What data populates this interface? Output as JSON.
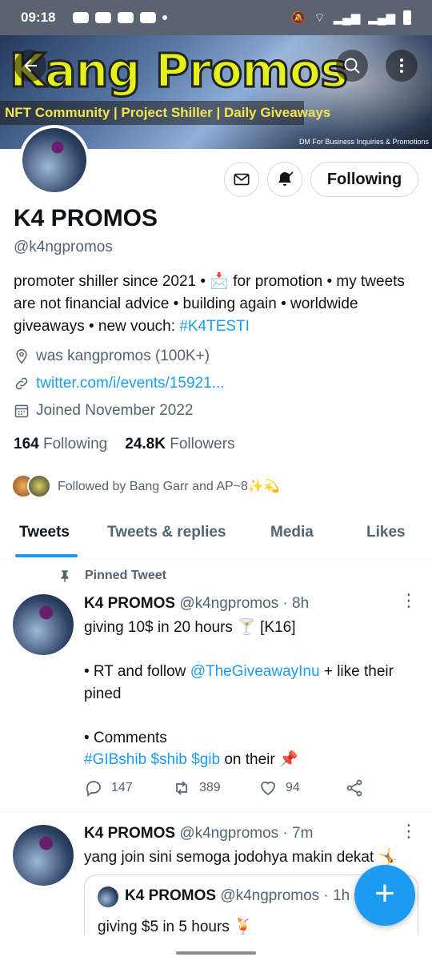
{
  "status_bar": {
    "time": "09:18"
  },
  "banner": {
    "brand": "Kang Promos",
    "tagline": "NFT Community | Project Shiller | Daily Giveaways",
    "small_text": "DM For Business Inquiries & Promotions"
  },
  "profile": {
    "name": "K4 PROMOS",
    "handle": "@k4ngpromos",
    "bio_text": "promoter shiller since 2021 • 📩 for promotion • my tweets are not financial advice • building again • worldwide giveaways • new vouch: ",
    "bio_link": "#K4TESTI",
    "location": "was kangpromos (100K+)",
    "website": "twitter.com/i/events/15921...",
    "joined": "Joined November 2022",
    "following_count": "164",
    "following_label": "Following",
    "followers_count": "24.8K",
    "followers_label": "Followers",
    "followed_by": "Followed by Bang Garr and AP~8✨💫",
    "follow_button": "Following"
  },
  "tabs": [
    "Tweets",
    "Tweets & replies",
    "Media",
    "Likes"
  ],
  "pinned_label": "Pinned Tweet",
  "tweets": [
    {
      "name": "K4 PROMOS",
      "meta": "@k4ngpromos · 8h",
      "line1": "giving 10$ in 20 hours 🍸 [K16]",
      "line2_pre": "• RT and follow ",
      "line2_link": "@TheGiveawayInu",
      "line2_post": " + like their pined",
      "line3": "• Comments",
      "line4_link": "#GIBshib $shib $gib",
      "line4_post": " on their 📌",
      "replies": "147",
      "retweets": "389",
      "likes": "94"
    },
    {
      "name": "K4 PROMOS",
      "meta": "@k4ngpromos · 7m",
      "text": "yang join sini semoga jodohya makin dekat 🤸",
      "quote_name": "K4 PROMOS",
      "quote_meta": "@k4ngpromos · 1h",
      "quote_text": "giving $5 in 5 hours 🍹"
    }
  ]
}
